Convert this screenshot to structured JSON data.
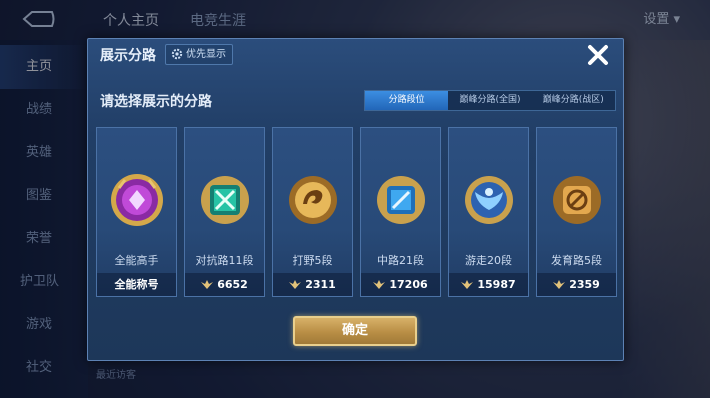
{
  "top_tabs": [
    "个人主页",
    "电竞生涯"
  ],
  "settings_label": "设置",
  "left_nav": [
    "主页",
    "战绩",
    "英雄",
    "图鉴",
    "荣誉",
    "护卫队",
    "游戏",
    "社交"
  ],
  "bottom_text": "最近访客",
  "modal": {
    "title": "展示分路",
    "pref_button": "优先显示",
    "subtitle": "请选择展示的分路",
    "segments": [
      "分路段位",
      "巅峰分路(全国)",
      "巅峰分路(战区)"
    ],
    "active_segment": 0,
    "cards": [
      {
        "name": "全能高手",
        "value": "全能称号",
        "icon": "all-round-emblem",
        "color": "#c04ad8"
      },
      {
        "name": "对抗路11段",
        "value": "6652",
        "icon": "clash-lane-emblem",
        "color": "#27c3a5"
      },
      {
        "name": "打野5段",
        "value": "2311",
        "icon": "jungle-dragon-emblem",
        "color": "#e7b85a"
      },
      {
        "name": "中路21段",
        "value": "17206",
        "icon": "mid-lane-emblem",
        "color": "#3fa8f0"
      },
      {
        "name": "游走20段",
        "value": "15987",
        "icon": "roam-wing-emblem",
        "color": "#4c8fe6"
      },
      {
        "name": "发育路5段",
        "value": "2359",
        "icon": "farm-lane-emblem",
        "color": "#e3a84e"
      }
    ],
    "confirm": "确定"
  }
}
